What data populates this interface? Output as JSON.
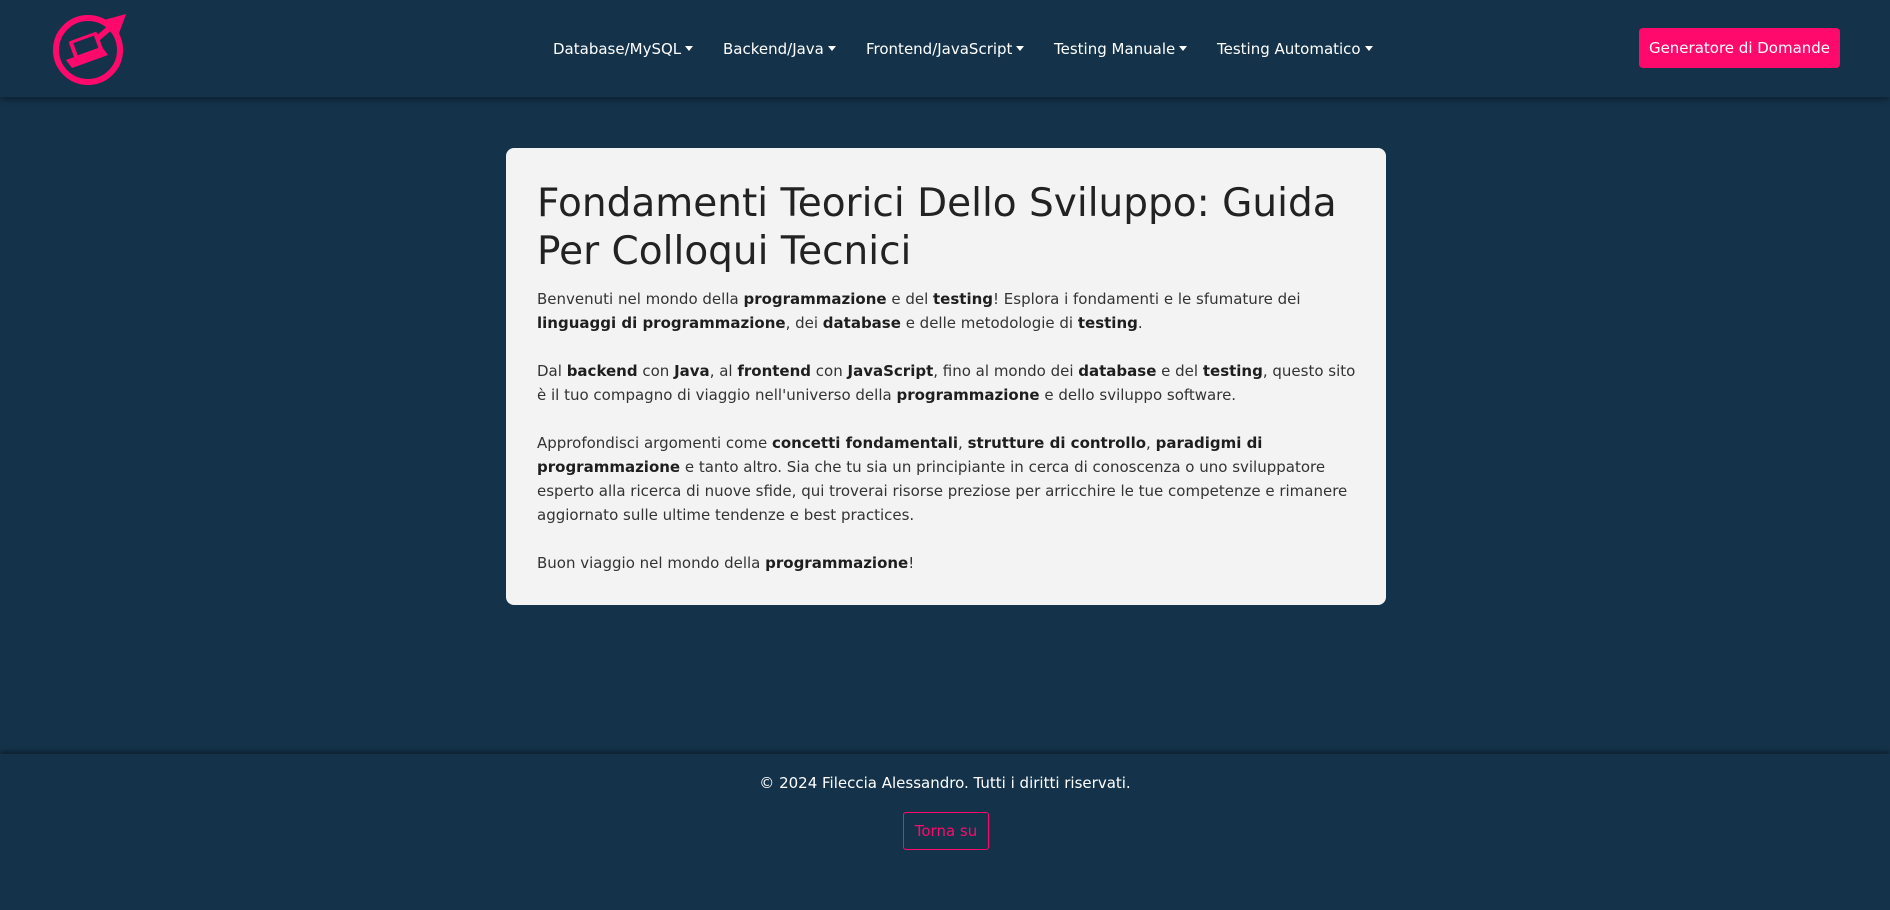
{
  "brand": {
    "accent_color": "#ff0a6c",
    "logo_icon": "laptop-rocket-logo-icon"
  },
  "nav": {
    "items": [
      {
        "label": "Database/MySQL",
        "dropdown": true
      },
      {
        "label": "Backend/Java",
        "dropdown": true
      },
      {
        "label": "Frontend/JavaScript",
        "dropdown": true
      },
      {
        "label": "Testing Manuale",
        "dropdown": true
      },
      {
        "label": "Testing Automatico",
        "dropdown": true
      }
    ],
    "cta_label": "Generatore di Domande"
  },
  "main": {
    "title": "Fondamenti Teorici Dello Sviluppo: Guida Per Colloqui Tecnici",
    "paragraphs": [
      [
        {
          "t": "Benvenuti nel mondo della "
        },
        {
          "t": "programmazione",
          "b": true
        },
        {
          "t": " e del "
        },
        {
          "t": "testing",
          "b": true
        },
        {
          "t": "! Esplora i fondamenti e le sfumature dei "
        },
        {
          "t": "linguaggi di programmazione",
          "b": true
        },
        {
          "t": ", dei "
        },
        {
          "t": "database",
          "b": true
        },
        {
          "t": " e delle metodologie di "
        },
        {
          "t": "testing",
          "b": true
        },
        {
          "t": "."
        }
      ],
      [
        {
          "t": "Dal "
        },
        {
          "t": "backend",
          "b": true
        },
        {
          "t": " con "
        },
        {
          "t": "Java",
          "b": true
        },
        {
          "t": ", al "
        },
        {
          "t": "frontend",
          "b": true
        },
        {
          "t": " con "
        },
        {
          "t": "JavaScript",
          "b": true
        },
        {
          "t": ", fino al mondo dei "
        },
        {
          "t": "database",
          "b": true
        },
        {
          "t": " e del "
        },
        {
          "t": "testing",
          "b": true
        },
        {
          "t": ", questo sito è il tuo compagno di viaggio nell'universo della "
        },
        {
          "t": "programmazione",
          "b": true
        },
        {
          "t": " e dello sviluppo software."
        }
      ],
      [
        {
          "t": "Approfondisci argomenti come "
        },
        {
          "t": "concetti fondamentali",
          "b": true
        },
        {
          "t": ", "
        },
        {
          "t": "strutture di controllo",
          "b": true
        },
        {
          "t": ", "
        },
        {
          "t": "paradigmi di programmazione",
          "b": true
        },
        {
          "t": " e tanto altro. Sia che tu sia un principiante in cerca di conoscenza o uno sviluppatore esperto alla ricerca di nuove sfide, qui troverai risorse preziose per arricchire le tue competenze e rimanere aggiornato sulle ultime tendenze e best practices."
        }
      ],
      [
        {
          "t": "Buon viaggio nel mondo della "
        },
        {
          "t": "programmazione",
          "b": true
        },
        {
          "t": "!"
        }
      ]
    ]
  },
  "footer": {
    "copyright": "© 2024 Fileccia Alessandro. Tutti i diritti riservati.",
    "back_to_top_label": "Torna su"
  }
}
